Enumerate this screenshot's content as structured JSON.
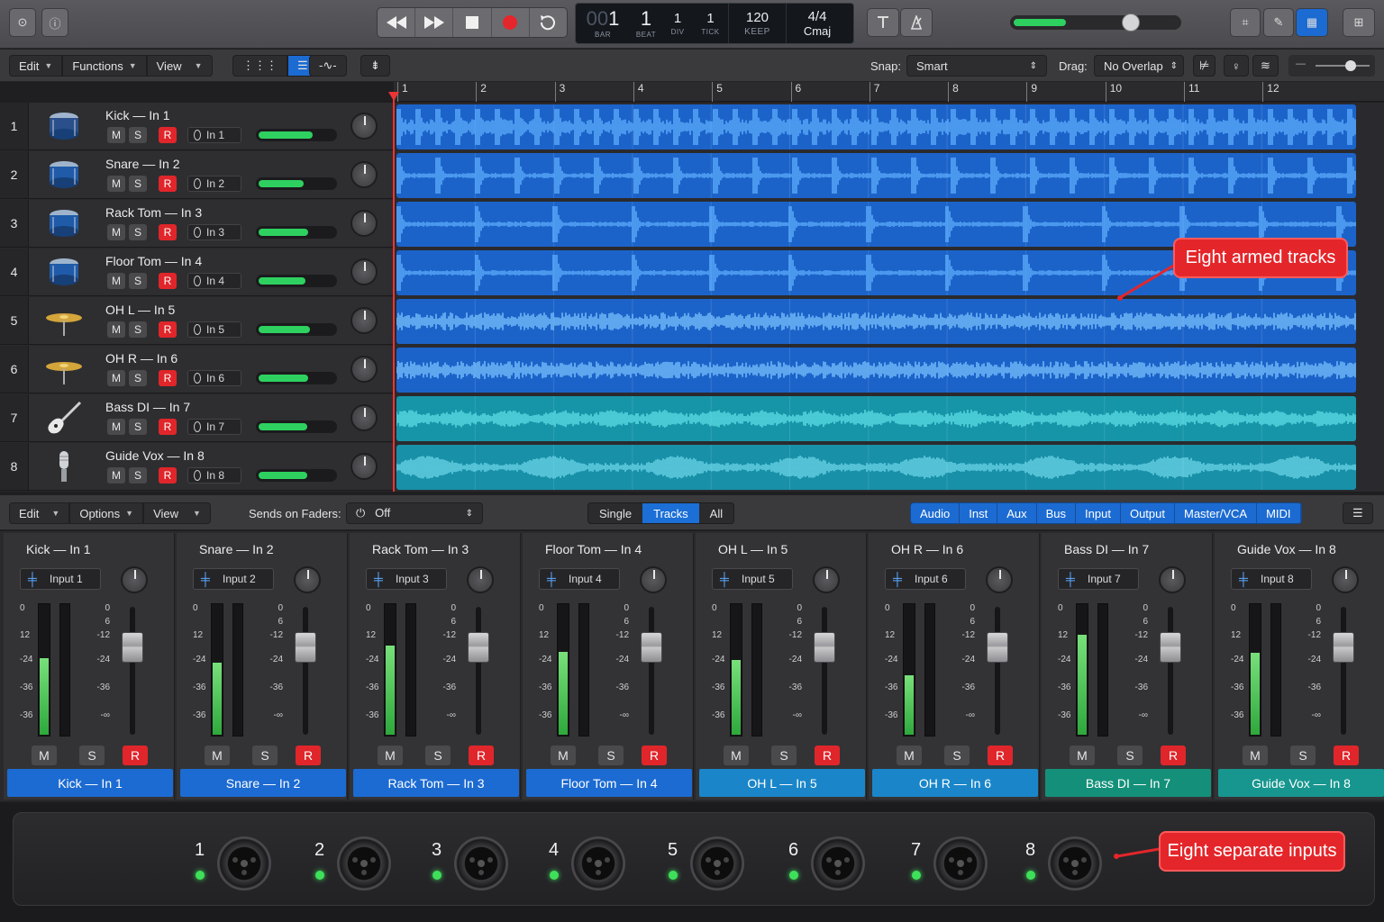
{
  "transport": {
    "bar": "1",
    "bar_prefix": "00",
    "beat": "1",
    "div": "1",
    "tick": "1",
    "bar_label": "BAR",
    "beat_label": "BEAT",
    "div_label": "DIV",
    "tick_label": "TICK",
    "tempo": "120",
    "tempo_label": "KEEP",
    "signature": "4/4",
    "key": "Cmaj"
  },
  "toolbar": {
    "edit": "Edit",
    "functions": "Functions",
    "view": "View",
    "snap_label": "Snap:",
    "snap_value": "Smart",
    "drag_label": "Drag:",
    "drag_value": "No Overlap"
  },
  "ruler": [
    "1",
    "2",
    "3",
    "4",
    "5",
    "6",
    "7",
    "8",
    "9",
    "10",
    "11",
    "12"
  ],
  "tracks": [
    {
      "num": "1",
      "name": "Kick — In 1",
      "input": "In 1",
      "color": "#1c63c9",
      "wave": "#5fb0ff",
      "level": 0.72
    },
    {
      "num": "2",
      "name": "Snare — In 2",
      "input": "In 2",
      "color": "#1c63c9",
      "wave": "#5fb0ff",
      "level": 0.6
    },
    {
      "num": "3",
      "name": "Rack Tom — In 3",
      "input": "In 3",
      "color": "#1c63c9",
      "wave": "#5fb0ff",
      "level": 0.66
    },
    {
      "num": "4",
      "name": "Floor Tom — In 4",
      "input": "In 4",
      "color": "#1c63c9",
      "wave": "#5fb0ff",
      "level": 0.62
    },
    {
      "num": "5",
      "name": "OH L — In 5",
      "input": "In 5",
      "color": "#1c63c9",
      "wave": "#7cc4ff",
      "level": 0.68
    },
    {
      "num": "6",
      "name": "OH R — In 6",
      "input": "In 6",
      "color": "#1c63c9",
      "wave": "#7cc4ff",
      "level": 0.66
    },
    {
      "num": "7",
      "name": "Bass DI — In 7",
      "input": "In 7",
      "color": "#1695a8",
      "wave": "#5fe0e8",
      "level": 0.64
    },
    {
      "num": "8",
      "name": "Guide Vox — In 8",
      "input": "In 8",
      "color": "#1890a8",
      "wave": "#6fd7ea",
      "level": 0.64
    }
  ],
  "track_buttons": {
    "mute": "M",
    "solo": "S",
    "rec": "R"
  },
  "callouts": {
    "armed": "Eight armed tracks",
    "inputs": "Eight separate inputs"
  },
  "mixer_bar": {
    "edit": "Edit",
    "options": "Options",
    "view": "View",
    "sends_label": "Sends on Faders:",
    "sends_value": "Off",
    "modes": [
      "Single",
      "Tracks",
      "All"
    ],
    "categories": [
      "Audio",
      "Inst",
      "Aux",
      "Bus",
      "Input",
      "Output",
      "Master/VCA",
      "MIDI"
    ]
  },
  "strips": [
    {
      "name": "Kick — In 1",
      "input": "Input 1",
      "level": 0.58,
      "label_color": "#1c6bd2"
    },
    {
      "name": "Snare — In 2",
      "input": "Input 2",
      "level": 0.55,
      "label_color": "#1c6bd2"
    },
    {
      "name": "Rack Tom — In 3",
      "input": "Input 3",
      "level": 0.68,
      "label_color": "#1c6bd2"
    },
    {
      "name": "Floor Tom — In 4",
      "input": "Input 4",
      "level": 0.63,
      "label_color": "#1c6bd2"
    },
    {
      "name": "OH L — In 5",
      "input": "Input 5",
      "level": 0.57,
      "label_color": "#1a86c9"
    },
    {
      "name": "OH R — In 6",
      "input": "Input 6",
      "level": 0.45,
      "label_color": "#1a86c9"
    },
    {
      "name": "Bass DI — In 7",
      "input": "Input 7",
      "level": 0.76,
      "label_color": "#14907a"
    },
    {
      "name": "Guide Vox — In 8",
      "input": "Input 8",
      "level": 0.62,
      "label_color": "#17968f"
    }
  ],
  "meter_scale_left": [
    "0",
    "12",
    "-24",
    "-36",
    "-36"
  ],
  "meter_scale_right": [
    "0",
    "6",
    "-12",
    "-24",
    "-36",
    "-∞"
  ],
  "hardware_inputs": [
    "1",
    "2",
    "3",
    "4",
    "5",
    "6",
    "7",
    "8"
  ]
}
